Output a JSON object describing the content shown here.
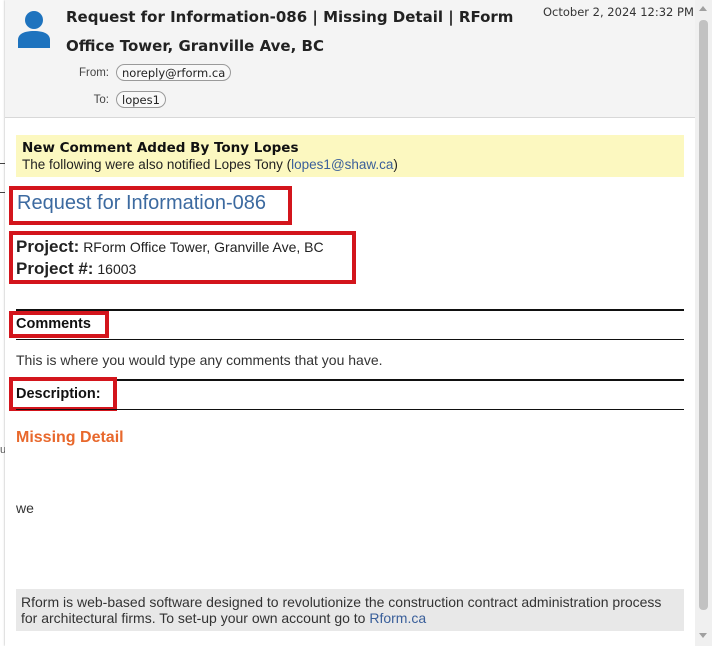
{
  "email": {
    "subject": "Request for Information-086 | Missing Detail | RForm Office Tower, Granville Ave, BC",
    "date": "October 2, 2024 12:32 PM",
    "from_label": "From:",
    "from": "noreply@rform.ca",
    "to_label": "To:",
    "to": "lopes1"
  },
  "notice": {
    "title": "New Comment Added By Tony Lopes",
    "text_prefix": "The following were also notified Lopes Tony (",
    "email": "lopes1@shaw.ca",
    "text_suffix": ")"
  },
  "rfi": {
    "title": "Request for Information-086",
    "project_label": "Project:",
    "project_value": "RForm Office Tower, Granville Ave, BC",
    "project_num_label": "Project #:",
    "project_num_value": "16003"
  },
  "comments": {
    "heading": "Comments",
    "text": "This is where you would type any comments that you have."
  },
  "description": {
    "heading": "Description:",
    "title": "Missing Detail",
    "text": "we"
  },
  "footer": {
    "text": "Rform is web-based software designed to revolutionize the construction contract administration process for architectural firms. To set-up your own account go to",
    "link": "Rform.ca"
  },
  "background": {
    "edge_glyph": "u"
  },
  "icons": {
    "avatar": "person-icon",
    "scroll_up": "arrow-up-icon",
    "scroll_down": "arrow-down-icon"
  },
  "colors": {
    "highlight_box": "#d3151c",
    "notice_bg": "#fcf8c0",
    "title_blue": "#3c6aa0",
    "link_blue": "#3a5f9a",
    "orange": "#e8682c",
    "avatar_blue": "#1e73be"
  }
}
